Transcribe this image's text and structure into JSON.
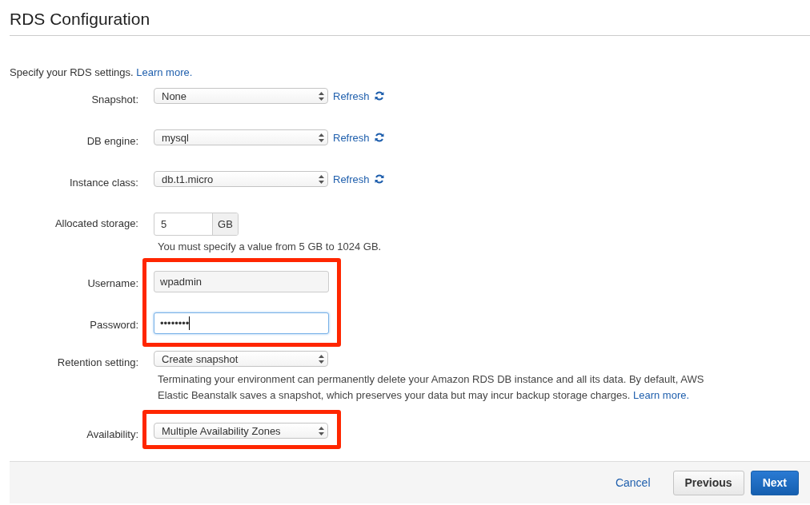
{
  "title": "RDS Configuration",
  "intro": {
    "text": "Specify your RDS settings.",
    "link": "Learn more."
  },
  "groups": [
    {
      "fields": [
        {
          "kind": "select",
          "label": "Snapshot:",
          "value": "None",
          "refresh": "Refresh"
        },
        {
          "kind": "select",
          "label": "DB engine:",
          "value": "mysql",
          "refresh": "Refresh"
        },
        {
          "kind": "select",
          "label": "Instance class:",
          "value": "db.t1.micro",
          "refresh": "Refresh"
        },
        {
          "kind": "addon",
          "label": "Allocated storage:",
          "value": "5",
          "addon": "GB",
          "hint": "You must specify a value from 5 GB to 1024 GB."
        }
      ]
    },
    {
      "highlighted": true,
      "fields": [
        {
          "kind": "text",
          "label": "Username:",
          "value": "wpadmin",
          "focused": false
        },
        {
          "kind": "text",
          "label": "Password:",
          "value": "••••••••",
          "focused": true
        }
      ]
    },
    {
      "fields": [
        {
          "kind": "select",
          "label": "Retention setting:",
          "value": "Create snapshot",
          "description": "Terminating your environment can permanently delete your Amazon RDS DB instance and all its data. By default, AWS Elastic Beanstalk saves a snapshot, which preserves your data but may incur backup storage charges.",
          "link": "Learn more."
        }
      ]
    },
    {
      "highlighted": true,
      "fields": [
        {
          "kind": "select",
          "label": "Availability:",
          "value": "Multiple Availability Zones"
        }
      ]
    }
  ],
  "footer": {
    "cancel": "Cancel",
    "previous": "Previous",
    "next": "Next"
  }
}
